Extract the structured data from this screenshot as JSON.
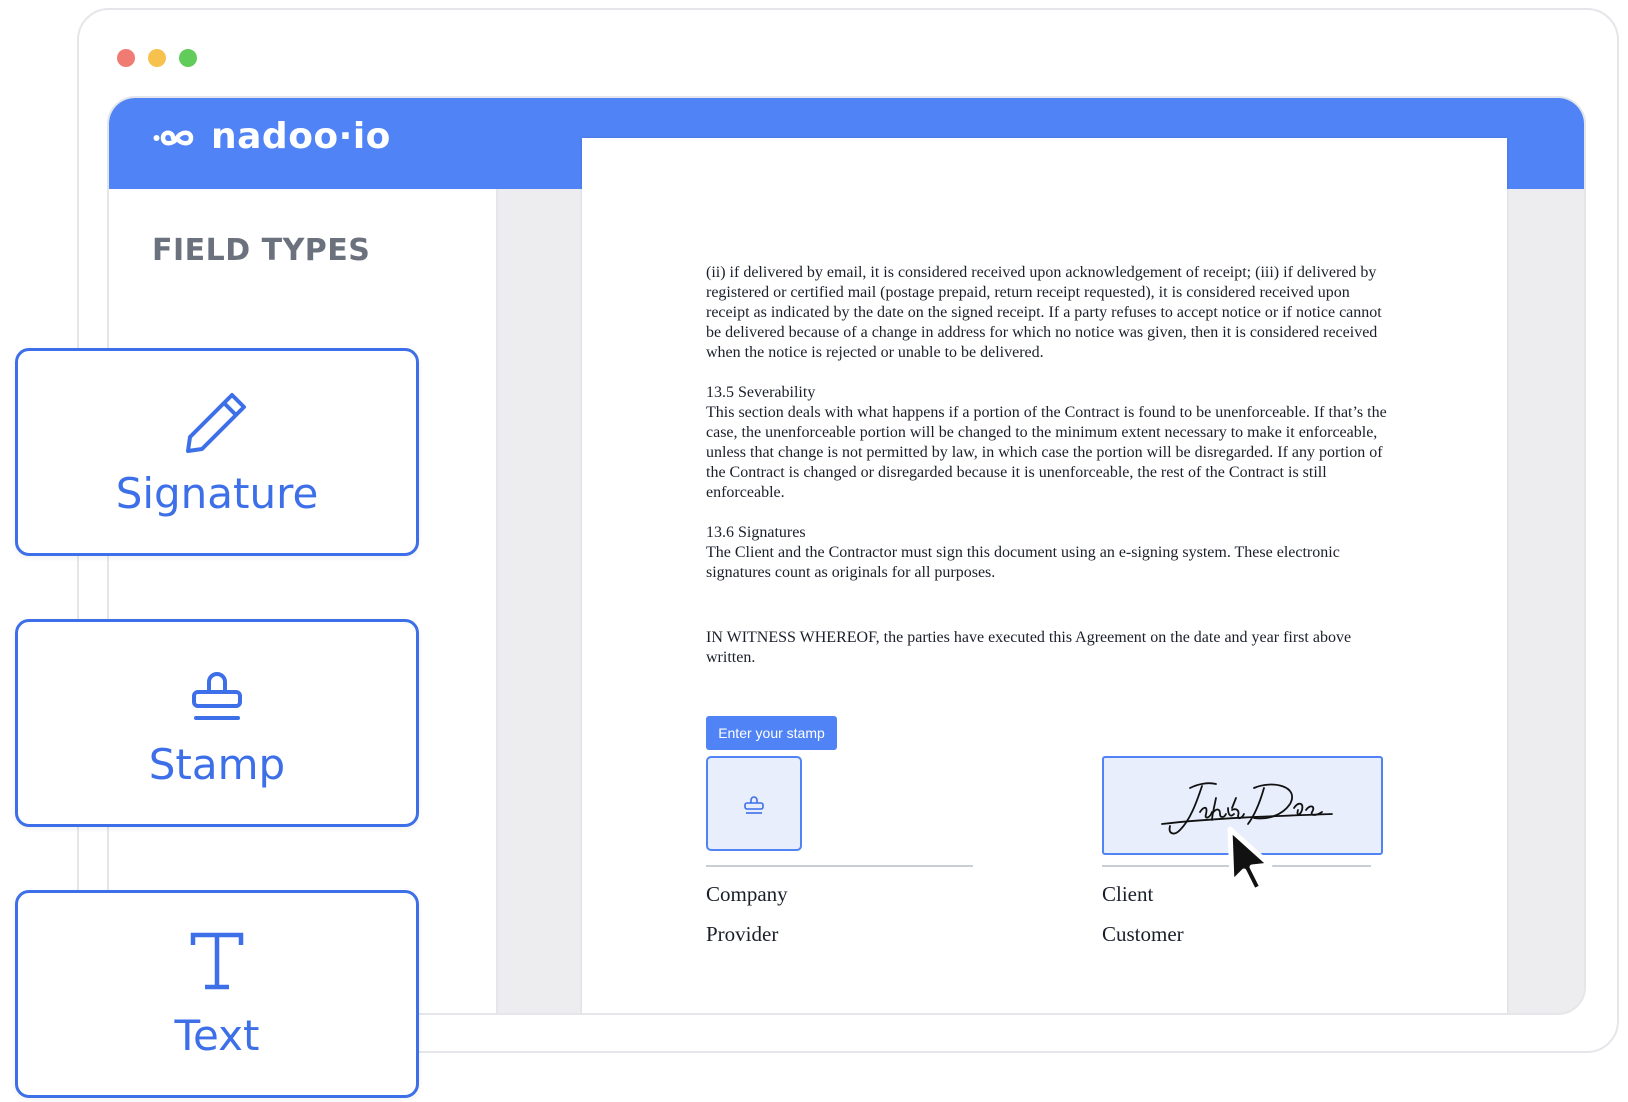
{
  "window": {
    "traffic_lights": {
      "close": "#f07b73",
      "minimize": "#f6c14c",
      "maximize": "#62cc5b"
    }
  },
  "app": {
    "logo_text": "nadoo·io",
    "header_color": "#5083f5"
  },
  "sidebar": {
    "title": "FIELD TYPES"
  },
  "field_types": [
    {
      "label": "Signature",
      "icon": "pen-icon"
    },
    {
      "label": "Stamp",
      "icon": "stamp-icon"
    },
    {
      "label": "Text",
      "icon": "text-icon"
    }
  ],
  "document": {
    "paragraphs": [
      "(ii) if delivered by email, it is considered received upon acknowledgement of receipt; (iii) if delivered by registered or certified mail (postage prepaid, return receipt requested), it is considered received upon receipt as indicated by the date on the signed receipt. If a party refuses to accept notice or if notice cannot be delivered because of a change in address for which no notice was given, then it is considered received when the notice is rejected or unable to be delivered.",
      "13.5 Severability",
      "This section deals with what happens if a portion of the Contract is found to be unenforceable. If that’s the case, the unenforceable portion will be changed to the minimum extent necessary to make it enforceable, unless that change is not permitted by law, in which case the portion will be disregarded. If any portion of the Contract is changed or disregarded because it is unenforceable, the rest of the Contract is still enforceable.",
      "13.6 Signatures",
      "The Client and the Contractor must sign this document using an e-signing system. These electronic signatures count as originals for all purposes.",
      "IN WITNESS WHEREOF, the parties have executed this Agreement on the date and year first above written."
    ],
    "stamp_prompt": "Enter your stamp",
    "signature_text": "John Doe",
    "left_party": {
      "line1": "Company",
      "line2": "Provider"
    },
    "right_party": {
      "line1": "Client",
      "line2": "Customer"
    }
  },
  "colors": {
    "accent": "#3d6fe8",
    "field_fill": "#e8eefc"
  }
}
